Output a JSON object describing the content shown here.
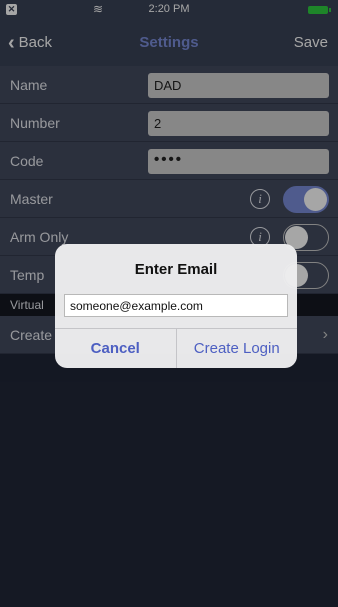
{
  "status_bar": {
    "time": "2:20 PM",
    "icons": [
      "app-badge-icon",
      "wifi-icon",
      "battery-icon"
    ],
    "battery_color": "#2ecc40"
  },
  "nav": {
    "back_label": "Back",
    "title": "Settings",
    "save_label": "Save",
    "title_color": "#7a8cd9"
  },
  "rows": {
    "name": {
      "label": "Name",
      "value": "DAD"
    },
    "number": {
      "label": "Number",
      "value": "2"
    },
    "code": {
      "label": "Code",
      "value": "••••"
    },
    "master": {
      "label": "Master",
      "on": true
    },
    "arm_only": {
      "label": "Arm Only",
      "on": false
    },
    "temp": {
      "label": "Temp",
      "on": false
    }
  },
  "section": {
    "virtual_header": "Virtual"
  },
  "create_row": {
    "label": "Create"
  },
  "alert": {
    "title": "Enter Email",
    "input_value": "someone@example.com",
    "cancel_label": "Cancel",
    "confirm_label": "Create Login",
    "button_color": "#4d5fc2"
  },
  "colors": {
    "background": "#202637",
    "row": "#434b5f",
    "accent": "#7a8cd9"
  }
}
